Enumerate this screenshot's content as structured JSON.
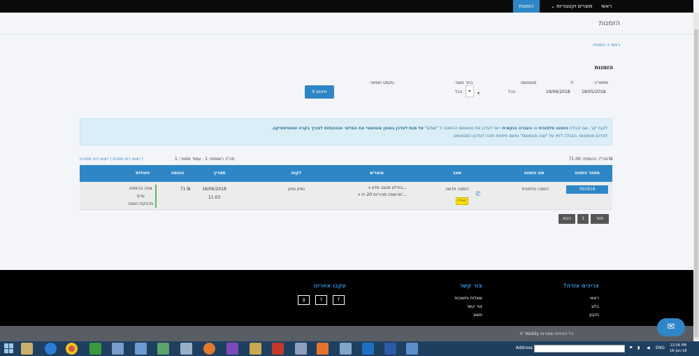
{
  "topnav": {
    "items": [
      "הזמנות",
      "מוצרים וקטגוריות",
      "ראשי"
    ]
  },
  "page": {
    "title": "הזמנות",
    "breadcrumb": "ראשי » הזמנות",
    "section_title": "הזמנות"
  },
  "filters": {
    "date_label": "מתאריך:",
    "to_label": "ל:",
    "status_label": "סטאטוס:",
    "source_label": "בחר מוצר:",
    "free_text_label": "טקסט חופשי:",
    "date_from": "18/05/2018",
    "date_to": "19/06/2018",
    "status_value": "הכל",
    "source_value": "הכל",
    "search_button": "חיפוש"
  },
  "info": {
    "line1_a": "לקוח יקר, אם קיבלת ",
    "line1_b": "הזמנה טלפונית",
    "line1_c": " או ",
    "line1_d": "העברה בנקאית",
    "line1_e": " ראוי לעדכן את סטאטוס ההזמנה ל \"שולם\" ",
    "line1_f": "על מנת לעדכן באופן אוטומטי את המלאי וההכנסות לצורך בקרה וסטטיסטיקה.",
    "line2": "לעדכון סטאטוס: בטבלה לחץ על \"שנה סטאטוס\" ומשם תיפתח תיבה לעדכון הסטאטוס."
  },
  "meta": {
    "links": "ייצוא דוח מסכם | ייצוא דוח מפורט |",
    "records": "סה\"כ רשומות: 1 , עמוד מספר: 1",
    "total": "סה\"כ הכנסות: 71.00 ₪"
  },
  "table": {
    "headers": [
      "מספר הזמנה",
      "סוג הזמנה",
      "מצב",
      "מוצרים",
      "לקוח",
      "תאריך",
      "הכנסה",
      "פעולות"
    ],
    "row": {
      "order_number": "301616",
      "order_type": "הזמנה טלפונית",
      "status": "הזמנה חדשה",
      "status_badge": "קיבלו",
      "product1": "« הודלון מנוגב מדון...",
      "product2": "« מרשמה סוכריות 20 יח'...",
      "customer": "נסיון נסיון",
      "date": "18/06/2018",
      "time": "11:03",
      "income": "71 ₪",
      "action1": "צפה בהזמנה",
      "action2": "ערוך",
      "action3": "מדבקת הפצה"
    }
  },
  "pagination": {
    "back": "חזור",
    "page": "1",
    "next": "הבא"
  },
  "footer": {
    "help_title": "צריכים עזרה?",
    "help_links": [
      "ראשי",
      "בלוג",
      "תקנון"
    ],
    "contact_title": "צור קשר",
    "contact_links": [
      "שאלות ותשובות",
      "צור קשר",
      "משוב"
    ],
    "follow_title": "עקבו אחרינו",
    "social": [
      "f",
      "t",
      "g"
    ],
    "copyright": "כל הזכויות שמורות Wobily ©"
  },
  "taskbar": {
    "address_label": "Address",
    "lang": "ENG",
    "time": "12:04 PM",
    "date": "18-Jun-18"
  },
  "colors": {
    "accent": "#2f86c6",
    "topbar": "#0a0a0a",
    "footer": "#000000",
    "info_bg": "#dbeef7"
  }
}
